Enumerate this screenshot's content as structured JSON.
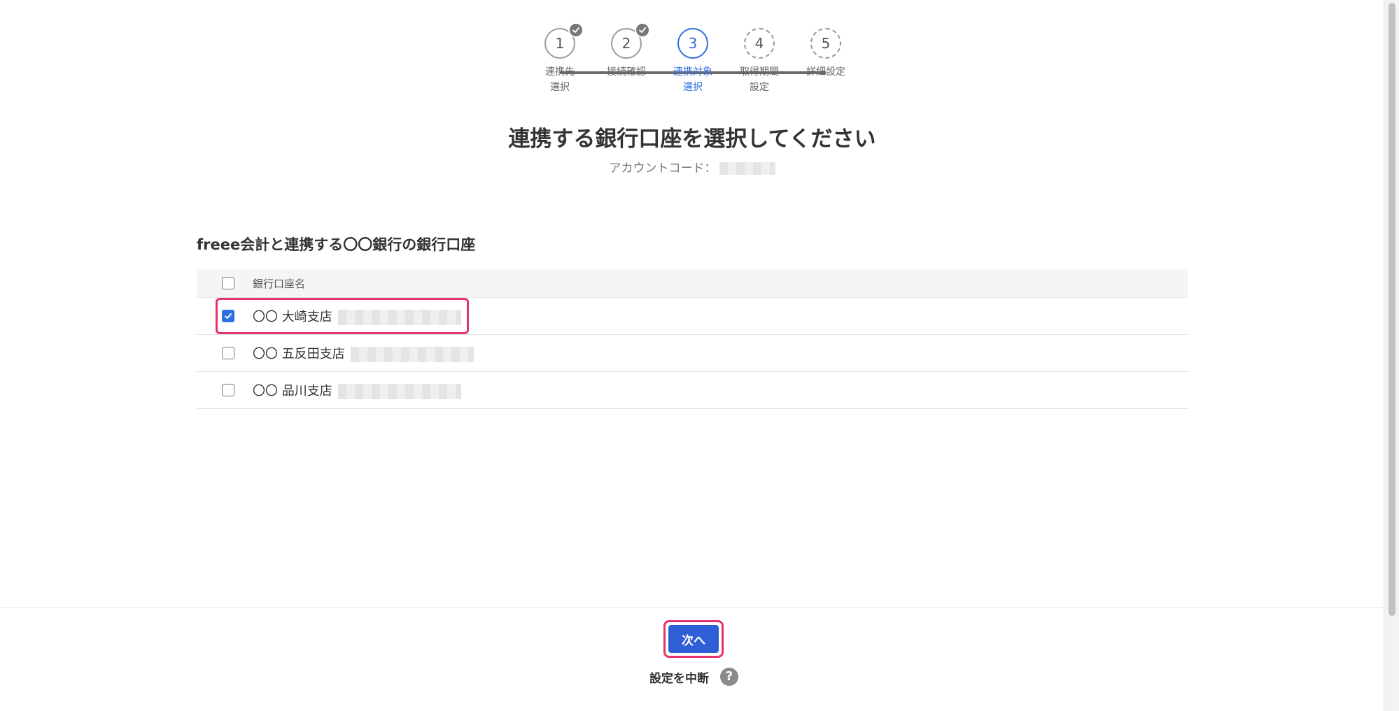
{
  "stepper": {
    "steps": [
      {
        "number": "1",
        "label": "連携先\n選択",
        "state": "done"
      },
      {
        "number": "2",
        "label": "接続確認",
        "state": "done"
      },
      {
        "number": "3",
        "label": "連携対象\n選択",
        "state": "current"
      },
      {
        "number": "4",
        "label": "取得期間\n設定",
        "state": "upcoming"
      },
      {
        "number": "5",
        "label": "詳細設定",
        "state": "upcoming"
      }
    ]
  },
  "heading": {
    "title": "連携する銀行口座を選択してください",
    "account_code_label": "アカウントコード："
  },
  "section": {
    "title": "freee会計と連携する〇〇銀行の銀行口座",
    "header_label": "銀行口座名",
    "rows": [
      {
        "label": "〇〇 大崎支店",
        "checked": true
      },
      {
        "label": "〇〇 五反田支店",
        "checked": false
      },
      {
        "label": "〇〇 品川支店",
        "checked": false
      }
    ]
  },
  "footer": {
    "next_label": "次へ",
    "abort_label": "設定を中断",
    "help_glyph": "?"
  },
  "colors": {
    "accent": "#2f6ee0",
    "button": "#2f5fd6",
    "highlight": "#e6336a"
  }
}
